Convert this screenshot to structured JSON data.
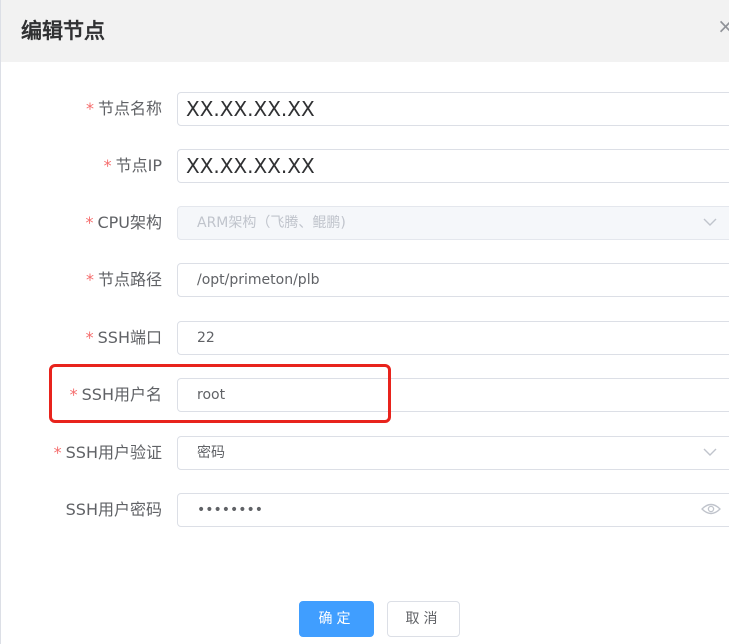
{
  "dialog": {
    "title": "编辑节点",
    "close_glyph": "×"
  },
  "form": {
    "fields": [
      {
        "label": "节点名称",
        "required": "*",
        "value": "XX.XX.XX.XX"
      },
      {
        "label": "节点IP",
        "required": "*",
        "value": "XX.XX.XX.XX"
      },
      {
        "label": "CPU架构",
        "required": "*",
        "value": "ARM架构（飞腾、鲲鹏)"
      },
      {
        "label": "节点路径",
        "required": "*",
        "value": "/opt/primeton/plb"
      },
      {
        "label": "SSH端口",
        "required": "*",
        "value": "22"
      },
      {
        "label": "SSH用户名",
        "required": "*",
        "value": "root"
      },
      {
        "label": "SSH用户验证",
        "required": "*",
        "value": "密码"
      },
      {
        "label": "SSH用户密码",
        "value": "••••••••"
      }
    ]
  },
  "footer": {
    "confirm_label": "确定",
    "cancel_label": "取消"
  },
  "icons": {
    "dropdown": "chevron-down-icon",
    "password_toggle": "eye-icon",
    "close": "close-icon"
  },
  "colors": {
    "primary": "#409eff",
    "required": "#f56c6c",
    "highlight": "#e8231c",
    "header_bg": "#f2f2f2"
  }
}
